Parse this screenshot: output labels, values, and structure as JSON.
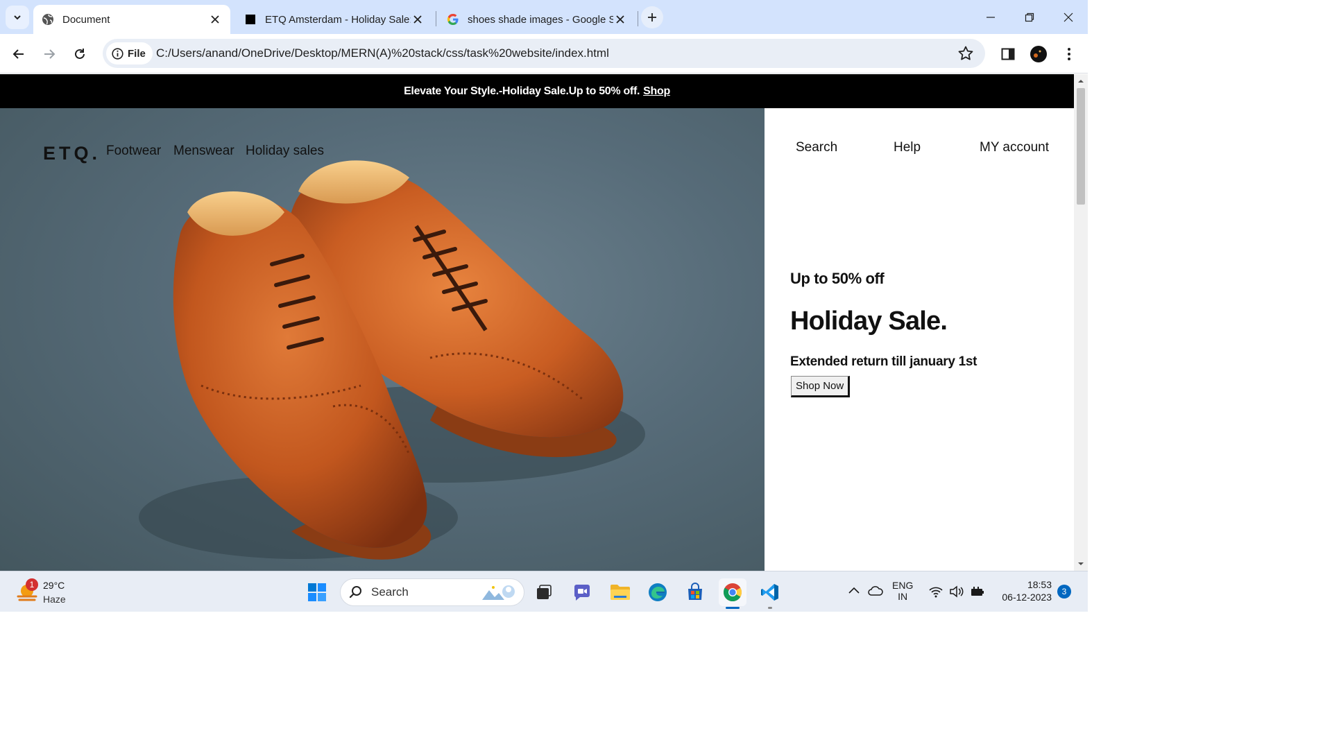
{
  "browser": {
    "tabs": [
      {
        "title": "Document",
        "active": true,
        "favicon": "globe-icon"
      },
      {
        "title": "ETQ Amsterdam - Holiday Sale:",
        "active": false,
        "favicon": "black-square-icon"
      },
      {
        "title": "shoes shade images - Google S",
        "active": false,
        "favicon": "google-icon"
      }
    ],
    "address": {
      "scheme_label": "File",
      "url": "C:/Users/anand/OneDrive/Desktop/MERN(A)%20stack/css/task%20website/index.html"
    }
  },
  "page": {
    "announcement": {
      "text": "Elevate Your Style.-Holiday Sale.Up to 50% off.",
      "link": "Shop"
    },
    "brand": "ETQ.",
    "nav": [
      "Footwear",
      "Menswear",
      "Holiday sales"
    ],
    "utility_nav": [
      "Search",
      "Help",
      "MY account"
    ],
    "promo": {
      "subtitle": "Up to 50% off",
      "title": "Holiday Sale.",
      "note": "Extended return till january 1st",
      "cta": "Shop Now"
    }
  },
  "taskbar": {
    "weather": {
      "temp": "29°C",
      "condition": "Haze",
      "badge": "1"
    },
    "search_placeholder": "Search",
    "language": {
      "line1": "ENG",
      "line2": "IN"
    },
    "clock": {
      "time": "18:53",
      "date": "06-12-2023"
    },
    "notification_count": "3"
  },
  "colors": {
    "tabstrip": "#d3e3fd",
    "announcement_bg": "#000000",
    "shoe_leather": "#c2571e",
    "hero_bg": "#566b78"
  }
}
